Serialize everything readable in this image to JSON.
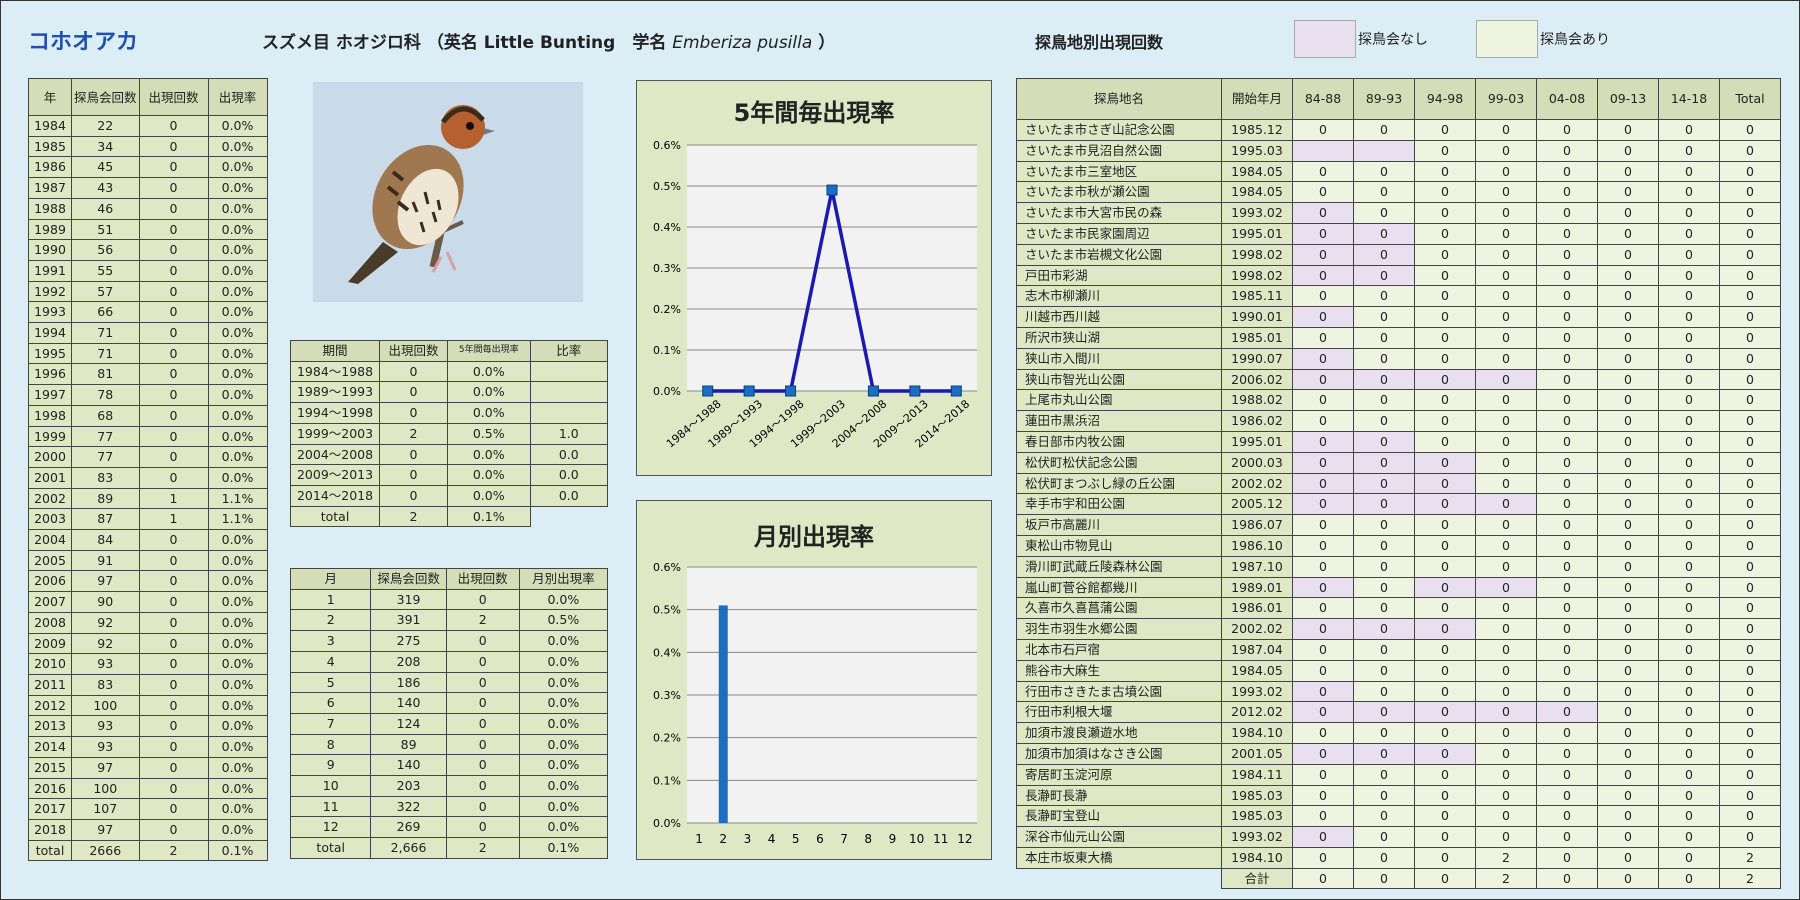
{
  "header": {
    "title": "コホオアカ",
    "taxon_main": "スズメ目 ホオジロ科 （英名 Little Bunting　学名 ",
    "taxon_sci": "Emberiza pusilla",
    "taxon_end": " ）",
    "loc_title": "探鳥地別出現回数",
    "legend_none": "探鳥会なし",
    "legend_ari": "探鳥会あり"
  },
  "colors": {
    "legend_none": "#e8e0f0",
    "legend_ari": "#eef4e0",
    "line": "#1a1ab0",
    "bar": "#1a6fc0"
  },
  "yearly": {
    "headers": [
      "年",
      "探鳥会回数",
      "出現回数",
      "出現率"
    ],
    "rows": [
      [
        "1984",
        "22",
        "0",
        "0.0%"
      ],
      [
        "1985",
        "34",
        "0",
        "0.0%"
      ],
      [
        "1986",
        "45",
        "0",
        "0.0%"
      ],
      [
        "1987",
        "43",
        "0",
        "0.0%"
      ],
      [
        "1988",
        "46",
        "0",
        "0.0%"
      ],
      [
        "1989",
        "51",
        "0",
        "0.0%"
      ],
      [
        "1990",
        "56",
        "0",
        "0.0%"
      ],
      [
        "1991",
        "55",
        "0",
        "0.0%"
      ],
      [
        "1992",
        "57",
        "0",
        "0.0%"
      ],
      [
        "1993",
        "66",
        "0",
        "0.0%"
      ],
      [
        "1994",
        "71",
        "0",
        "0.0%"
      ],
      [
        "1995",
        "71",
        "0",
        "0.0%"
      ],
      [
        "1996",
        "81",
        "0",
        "0.0%"
      ],
      [
        "1997",
        "78",
        "0",
        "0.0%"
      ],
      [
        "1998",
        "68",
        "0",
        "0.0%"
      ],
      [
        "1999",
        "77",
        "0",
        "0.0%"
      ],
      [
        "2000",
        "77",
        "0",
        "0.0%"
      ],
      [
        "2001",
        "83",
        "0",
        "0.0%"
      ],
      [
        "2002",
        "89",
        "1",
        "1.1%"
      ],
      [
        "2003",
        "87",
        "1",
        "1.1%"
      ],
      [
        "2004",
        "84",
        "0",
        "0.0%"
      ],
      [
        "2005",
        "91",
        "0",
        "0.0%"
      ],
      [
        "2006",
        "97",
        "0",
        "0.0%"
      ],
      [
        "2007",
        "90",
        "0",
        "0.0%"
      ],
      [
        "2008",
        "92",
        "0",
        "0.0%"
      ],
      [
        "2009",
        "92",
        "0",
        "0.0%"
      ],
      [
        "2010",
        "93",
        "0",
        "0.0%"
      ],
      [
        "2011",
        "83",
        "0",
        "0.0%"
      ],
      [
        "2012",
        "100",
        "0",
        "0.0%"
      ],
      [
        "2013",
        "93",
        "0",
        "0.0%"
      ],
      [
        "2014",
        "93",
        "0",
        "0.0%"
      ],
      [
        "2015",
        "97",
        "0",
        "0.0%"
      ],
      [
        "2016",
        "100",
        "0",
        "0.0%"
      ],
      [
        "2017",
        "107",
        "0",
        "0.0%"
      ],
      [
        "2018",
        "97",
        "0",
        "0.0%"
      ],
      [
        "total",
        "2666",
        "2",
        "0.1%"
      ]
    ]
  },
  "period": {
    "headers": [
      "期間",
      "出現回数",
      "5年間毎出現率",
      "比率"
    ],
    "rows": [
      [
        "1984～1988",
        "0",
        "0.0%",
        ""
      ],
      [
        "1989～1993",
        "0",
        "0.0%",
        ""
      ],
      [
        "1994～1998",
        "0",
        "0.0%",
        ""
      ],
      [
        "1999～2003",
        "2",
        "0.5%",
        "1.0"
      ],
      [
        "2004～2008",
        "0",
        "0.0%",
        "0.0"
      ],
      [
        "2009～2013",
        "0",
        "0.0%",
        "0.0"
      ],
      [
        "2014～2018",
        "0",
        "0.0%",
        "0.0"
      ],
      [
        "total",
        "2",
        "0.1%",
        ""
      ]
    ]
  },
  "monthly": {
    "headers": [
      "月",
      "探鳥会回数",
      "出現回数",
      "月別出現率"
    ],
    "rows": [
      [
        "1",
        "319",
        "0",
        "0.0%"
      ],
      [
        "2",
        "391",
        "2",
        "0.5%"
      ],
      [
        "3",
        "275",
        "0",
        "0.0%"
      ],
      [
        "4",
        "208",
        "0",
        "0.0%"
      ],
      [
        "5",
        "186",
        "0",
        "0.0%"
      ],
      [
        "6",
        "140",
        "0",
        "0.0%"
      ],
      [
        "7",
        "124",
        "0",
        "0.0%"
      ],
      [
        "8",
        "89",
        "0",
        "0.0%"
      ],
      [
        "9",
        "140",
        "0",
        "0.0%"
      ],
      [
        "10",
        "203",
        "0",
        "0.0%"
      ],
      [
        "11",
        "322",
        "0",
        "0.0%"
      ],
      [
        "12",
        "269",
        "0",
        "0.0%"
      ],
      [
        "total",
        "2,666",
        "2",
        "0.1%"
      ]
    ]
  },
  "chart_data": [
    {
      "type": "line",
      "title": "5年間毎出現率",
      "categories": [
        "1984～1988",
        "1989～1993",
        "1994～1998",
        "1999～2003",
        "2004～2008",
        "2009～2013",
        "2014～2018"
      ],
      "values": [
        0,
        0,
        0,
        0.49,
        0,
        0,
        0
      ],
      "yticks": [
        "0.0%",
        "0.1%",
        "0.2%",
        "0.3%",
        "0.4%",
        "0.5%",
        "0.6%"
      ],
      "ylim": [
        0,
        0.6
      ],
      "grid": true
    },
    {
      "type": "bar",
      "title": "月別出現率",
      "categories": [
        "1",
        "2",
        "3",
        "4",
        "5",
        "6",
        "7",
        "8",
        "9",
        "10",
        "11",
        "12"
      ],
      "values": [
        0,
        0.51,
        0,
        0,
        0,
        0,
        0,
        0,
        0,
        0,
        0,
        0
      ],
      "yticks": [
        "0.0%",
        "0.1%",
        "0.2%",
        "0.3%",
        "0.4%",
        "0.5%",
        "0.6%"
      ],
      "ylim": [
        0,
        0.6
      ],
      "grid": true
    }
  ],
  "locations": {
    "headers": [
      "探鳥地名",
      "開始年月",
      "84-88",
      "89-93",
      "94-98",
      "99-03",
      "04-08",
      "09-13",
      "14-18",
      "Total"
    ],
    "rows": [
      {
        "name": "さいたま市さぎ山記念公園",
        "start": "1985.12",
        "v": [
          "0",
          "0",
          "0",
          "0",
          "0",
          "0",
          "0",
          "0"
        ],
        "none": []
      },
      {
        "name": "さいたま市見沼自然公園",
        "start": "1995.03",
        "v": [
          "",
          "",
          "0",
          "0",
          "0",
          "0",
          "0",
          "0"
        ],
        "none": [
          0,
          1
        ]
      },
      {
        "name": "さいたま市三室地区",
        "start": "1984.05",
        "v": [
          "0",
          "0",
          "0",
          "0",
          "0",
          "0",
          "0",
          "0"
        ],
        "none": []
      },
      {
        "name": "さいたま市秋が瀬公園",
        "start": "1984.05",
        "v": [
          "0",
          "0",
          "0",
          "0",
          "0",
          "0",
          "0",
          "0"
        ],
        "none": []
      },
      {
        "name": "さいたま市大宮市民の森",
        "start": "1993.02",
        "v": [
          "0",
          "0",
          "0",
          "0",
          "0",
          "0",
          "0",
          "0"
        ],
        "none": [
          0
        ]
      },
      {
        "name": "さいたま市民家園周辺",
        "start": "1995.01",
        "v": [
          "0",
          "0",
          "0",
          "0",
          "0",
          "0",
          "0",
          "0"
        ],
        "none": [
          0,
          1
        ]
      },
      {
        "name": "さいたま市岩槻文化公園",
        "start": "1998.02",
        "v": [
          "0",
          "0",
          "0",
          "0",
          "0",
          "0",
          "0",
          "0"
        ],
        "none": [
          0,
          1
        ]
      },
      {
        "name": "戸田市彩湖",
        "start": "1998.02",
        "v": [
          "0",
          "0",
          "0",
          "0",
          "0",
          "0",
          "0",
          "0"
        ],
        "none": [
          0,
          1
        ]
      },
      {
        "name": "志木市柳瀬川",
        "start": "1985.11",
        "v": [
          "0",
          "0",
          "0",
          "0",
          "0",
          "0",
          "0",
          "0"
        ],
        "none": []
      },
      {
        "name": "川越市西川越",
        "start": "1990.01",
        "v": [
          "0",
          "0",
          "0",
          "0",
          "0",
          "0",
          "0",
          "0"
        ],
        "none": [
          0
        ]
      },
      {
        "name": "所沢市狭山湖",
        "start": "1985.01",
        "v": [
          "0",
          "0",
          "0",
          "0",
          "0",
          "0",
          "0",
          "0"
        ],
        "none": []
      },
      {
        "name": "狭山市入間川",
        "start": "1990.07",
        "v": [
          "0",
          "0",
          "0",
          "0",
          "0",
          "0",
          "0",
          "0"
        ],
        "none": [
          0
        ]
      },
      {
        "name": "狭山市智光山公園",
        "start": "2006.02",
        "v": [
          "0",
          "0",
          "0",
          "0",
          "0",
          "0",
          "0",
          "0"
        ],
        "none": [
          0,
          1,
          2,
          3
        ]
      },
      {
        "name": "上尾市丸山公園",
        "start": "1988.02",
        "v": [
          "0",
          "0",
          "0",
          "0",
          "0",
          "0",
          "0",
          "0"
        ],
        "none": []
      },
      {
        "name": "蓮田市黒浜沼",
        "start": "1986.02",
        "v": [
          "0",
          "0",
          "0",
          "0",
          "0",
          "0",
          "0",
          "0"
        ],
        "none": []
      },
      {
        "name": "春日部市内牧公園",
        "start": "1995.01",
        "v": [
          "0",
          "0",
          "0",
          "0",
          "0",
          "0",
          "0",
          "0"
        ],
        "none": [
          0,
          1
        ]
      },
      {
        "name": "松伏町松伏記念公園",
        "start": "2000.03",
        "v": [
          "0",
          "0",
          "0",
          "0",
          "0",
          "0",
          "0",
          "0"
        ],
        "none": [
          0,
          1,
          2
        ]
      },
      {
        "name": "松伏町まつぶし緑の丘公園",
        "start": "2002.02",
        "v": [
          "0",
          "0",
          "0",
          "0",
          "0",
          "0",
          "0",
          "0"
        ],
        "none": [
          0,
          1,
          2
        ]
      },
      {
        "name": "幸手市宇和田公園",
        "start": "2005.12",
        "v": [
          "0",
          "0",
          "0",
          "0",
          "0",
          "0",
          "0",
          "0"
        ],
        "none": [
          0,
          1,
          2,
          3
        ]
      },
      {
        "name": "坂戸市高麗川",
        "start": "1986.07",
        "v": [
          "0",
          "0",
          "0",
          "0",
          "0",
          "0",
          "0",
          "0"
        ],
        "none": []
      },
      {
        "name": "東松山市物見山",
        "start": "1986.10",
        "v": [
          "0",
          "0",
          "0",
          "0",
          "0",
          "0",
          "0",
          "0"
        ],
        "none": []
      },
      {
        "name": "滑川町武蔵丘陵森林公園",
        "start": "1987.10",
        "v": [
          "0",
          "0",
          "0",
          "0",
          "0",
          "0",
          "0",
          "0"
        ],
        "none": []
      },
      {
        "name": "嵐山町菅谷館都幾川",
        "start": "1989.01",
        "v": [
          "0",
          "0",
          "0",
          "0",
          "0",
          "0",
          "0",
          "0"
        ],
        "none": [
          0,
          2,
          3
        ]
      },
      {
        "name": "久喜市久喜菖蒲公園",
        "start": "1986.01",
        "v": [
          "0",
          "0",
          "0",
          "0",
          "0",
          "0",
          "0",
          "0"
        ],
        "none": []
      },
      {
        "name": "羽生市羽生水郷公園",
        "start": "2002.02",
        "v": [
          "0",
          "0",
          "0",
          "0",
          "0",
          "0",
          "0",
          "0"
        ],
        "none": [
          0,
          1,
          2
        ]
      },
      {
        "name": "北本市石戸宿",
        "start": "1987.04",
        "v": [
          "0",
          "0",
          "0",
          "0",
          "0",
          "0",
          "0",
          "0"
        ],
        "none": []
      },
      {
        "name": "熊谷市大麻生",
        "start": "1984.05",
        "v": [
          "0",
          "0",
          "0",
          "0",
          "0",
          "0",
          "0",
          "0"
        ],
        "none": []
      },
      {
        "name": "行田市さきたま古墳公園",
        "start": "1993.02",
        "v": [
          "0",
          "0",
          "0",
          "0",
          "0",
          "0",
          "0",
          "0"
        ],
        "none": [
          0
        ]
      },
      {
        "name": "行田市利根大堰",
        "start": "2012.02",
        "v": [
          "0",
          "0",
          "0",
          "0",
          "0",
          "0",
          "0",
          "0"
        ],
        "none": [
          0,
          1,
          2,
          3,
          4
        ]
      },
      {
        "name": "加須市渡良瀬遊水地",
        "start": "1984.10",
        "v": [
          "0",
          "0",
          "0",
          "0",
          "0",
          "0",
          "0",
          "0"
        ],
        "none": []
      },
      {
        "name": "加須市加須はなさき公園",
        "start": "2001.05",
        "v": [
          "0",
          "0",
          "0",
          "0",
          "0",
          "0",
          "0",
          "0"
        ],
        "none": [
          0,
          1,
          2
        ]
      },
      {
        "name": "寄居町玉淀河原",
        "start": "1984.11",
        "v": [
          "0",
          "0",
          "0",
          "0",
          "0",
          "0",
          "0",
          "0"
        ],
        "none": []
      },
      {
        "name": "長瀞町長瀞",
        "start": "1985.03",
        "v": [
          "0",
          "0",
          "0",
          "0",
          "0",
          "0",
          "0",
          "0"
        ],
        "none": []
      },
      {
        "name": "長瀞町宝登山",
        "start": "1985.03",
        "v": [
          "0",
          "0",
          "0",
          "0",
          "0",
          "0",
          "0",
          "0"
        ],
        "none": []
      },
      {
        "name": "深谷市仙元山公園",
        "start": "1993.02",
        "v": [
          "0",
          "0",
          "0",
          "0",
          "0",
          "0",
          "0",
          "0"
        ],
        "none": [
          0
        ]
      },
      {
        "name": "本庄市坂東大橋",
        "start": "1984.10",
        "v": [
          "0",
          "0",
          "0",
          "2",
          "0",
          "0",
          "0",
          "2"
        ],
        "none": []
      }
    ],
    "total": {
      "label": "合計",
      "v": [
        "0",
        "0",
        "0",
        "2",
        "0",
        "0",
        "0",
        "2"
      ]
    }
  }
}
